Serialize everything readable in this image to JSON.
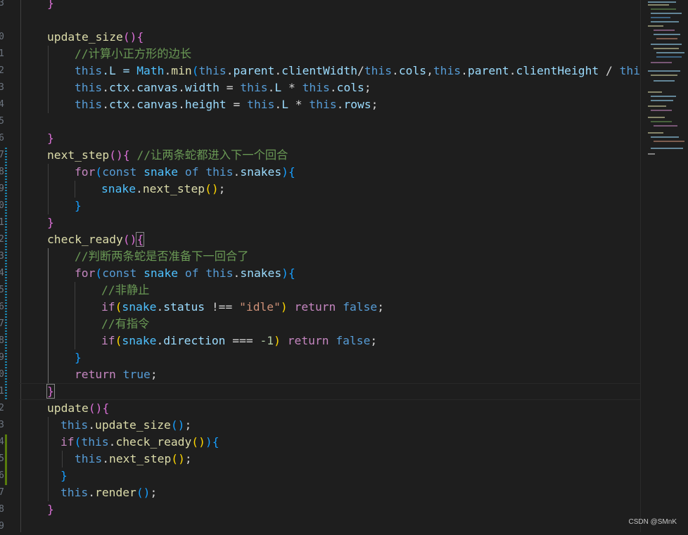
{
  "gutter": {
    "line_numbers": [
      "3",
      "",
      "0",
      "1",
      "2",
      "3",
      "4",
      "5",
      "6",
      "7",
      "8",
      "9",
      "0",
      "1",
      "2",
      "3",
      "4",
      "5",
      "6",
      "7",
      "8",
      "9",
      "0",
      "1",
      "2",
      "3",
      "4",
      "5",
      "6",
      "7",
      "8",
      "9",
      "0"
    ]
  },
  "code": {
    "l00": "}",
    "l02_name": "update_size",
    "l03_comment": "//计算小正方形的边长",
    "l04_a": "this",
    "l04_b": ".L = ",
    "l04_c": "Math",
    "l04_d": ".",
    "l04_e": "min",
    "l04_f": "this",
    "l04_g": "parent",
    "l04_h": "clientWidth",
    "l04_i": "this",
    "l04_j": "cols",
    "l04_k": "this",
    "l04_l": "parent",
    "l04_m": "clientHeight",
    "l04_n": "this",
    "l05_a": "this",
    "l05_b": "ctx",
    "l05_c": "canvas",
    "l05_d": "width",
    "l05_e": "this",
    "l05_f": "L",
    "l05_g": "this",
    "l05_h": "cols",
    "l06_a": "this",
    "l06_b": "ctx",
    "l06_c": "canvas",
    "l06_d": "height",
    "l06_e": "this",
    "l06_f": "L",
    "l06_g": "this",
    "l06_h": "rows",
    "l09_name": "next_step",
    "l09_comment": "//让两条蛇都进入下一个回合",
    "l10_for": "for",
    "l10_const": "const",
    "l10_snake": "snake",
    "l10_of": "of",
    "l10_this": "this",
    "l10_snakes": "snakes",
    "l11_snake": "snake",
    "l11_fn": "next_step",
    "l14_name": "check_ready",
    "l15_comment": "//判断两条蛇是否准备下一回合了",
    "l16_for": "for",
    "l16_const": "const",
    "l16_snake": "snake",
    "l16_of": "of",
    "l16_this": "this",
    "l16_snakes": "snakes",
    "l17_comment": "//非静止",
    "l18_if": "if",
    "l18_snake": "snake",
    "l18_status": "status",
    "l18_op": " !== ",
    "l18_str": "\"idle\"",
    "l18_return": "return",
    "l18_false": "false",
    "l19_comment": "//有指令",
    "l20_if": "if",
    "l20_snake": "snake",
    "l20_dir": "direction",
    "l20_op": " === ",
    "l20_num": "-1",
    "l20_return": "return",
    "l20_false": "false",
    "l22_return": "return",
    "l22_true": "true",
    "l24_name": "update",
    "l25_this": "this",
    "l25_fn": "update_size",
    "l26_if": "if",
    "l26_this": "this",
    "l26_fn": "check_ready",
    "l27_this": "this",
    "l27_fn": "next_step",
    "l29_this": "this",
    "l29_fn": "render"
  },
  "watermark": "CSDN @SMnK",
  "colors": {
    "background": "#1e1e1e",
    "keyword": "#569cd6",
    "control": "#c586c0",
    "function": "#dcdcaa",
    "property": "#9cdcfe",
    "string": "#ce9178",
    "comment": "#6a9955"
  }
}
